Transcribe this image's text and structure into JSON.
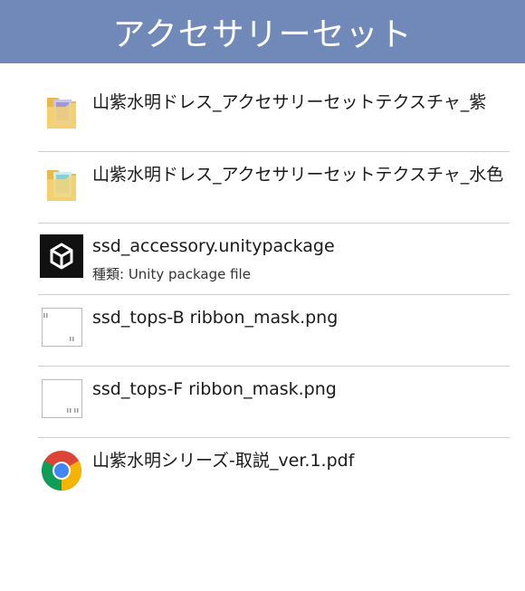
{
  "header": {
    "title": "アクセサリーセット"
  },
  "files": [
    {
      "name": "山紫水明ドレス_アクセサリーセットテクスチャ_紫",
      "icon": "folder-purple-icon"
    },
    {
      "name": "山紫水明ドレス_アクセサリーセットテクスチャ_水色",
      "icon": "folder-lightblue-icon"
    },
    {
      "name": "ssd_accessory.unitypackage",
      "sub": "種類: Unity package file",
      "icon": "unity-icon"
    },
    {
      "name": "ssd_tops-B ribbon_mask.png",
      "icon": "image-thumbnail-icon"
    },
    {
      "name": "ssd_tops-F ribbon_mask.png",
      "icon": "image-thumbnail-icon"
    },
    {
      "name": "山紫水明シリーズ-取説_ver.1.pdf",
      "icon": "chrome-icon"
    }
  ],
  "colors": {
    "header_bg": "#7189b9",
    "divider": "#cfcfcf"
  }
}
